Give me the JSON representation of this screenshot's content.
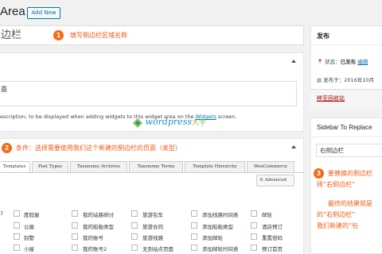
{
  "header": {
    "title": "Area",
    "add_new": "Add New"
  },
  "title_field": {
    "value": "边栏"
  },
  "annotations": {
    "step1": {
      "num": "1",
      "text": "填写侧边栏区域名称"
    },
    "step2": {
      "num": "2",
      "text": "条件：选择需要使用我们这个新建的侧边栏的页面（类型）"
    },
    "step3": {
      "num": "3",
      "line1": "要替换的侧边栏",
      "line2": "择“右侧边栏”",
      "line3": "最终的结果就是",
      "line4": "的“右侧边栏”",
      "line5": "我们新建的“包"
    }
  },
  "description": {
    "textarea_value": "面",
    "note_prefix": "escription, to be displayed when adding widgets to this widget area on the ",
    "note_link": "Widgets",
    "note_suffix": " screen."
  },
  "tabs": [
    "Templates",
    "Post Types",
    "Taxonomy Archives",
    "Taxonomy Terms",
    "Template Hierarchy",
    "WooCommerce"
  ],
  "advanced_label": "Advanced",
  "checkbox_rows": [
    [
      "度假屋",
      "我的站路研讨",
      "旅游包车",
      "添加线路时间表",
      "邮轮"
    ],
    [
      "公屋",
      "我的船舶类型",
      "旅游合同",
      "添加船舶类型",
      "酒店预订"
    ],
    [
      "别墅",
      "我的账号",
      "旅游线路",
      "添加邮轮",
      "重置密码"
    ],
    [
      "小屋",
      "我的账号2",
      "无到站点页面",
      "添加邮轮时间表",
      "预订首页"
    ]
  ],
  "left_num": "7",
  "publish": {
    "title": "发布",
    "status_label": "状态：",
    "status_value": "已发布",
    "edit": "编辑",
    "date_label": "发布于：2016年10月",
    "trash": "移至回收站"
  },
  "replace": {
    "title": "Sidebar To Replace",
    "selected": "右侧边栏"
  },
  "watermark": {
    "text": "wordpress",
    "cn": "大学"
  }
}
